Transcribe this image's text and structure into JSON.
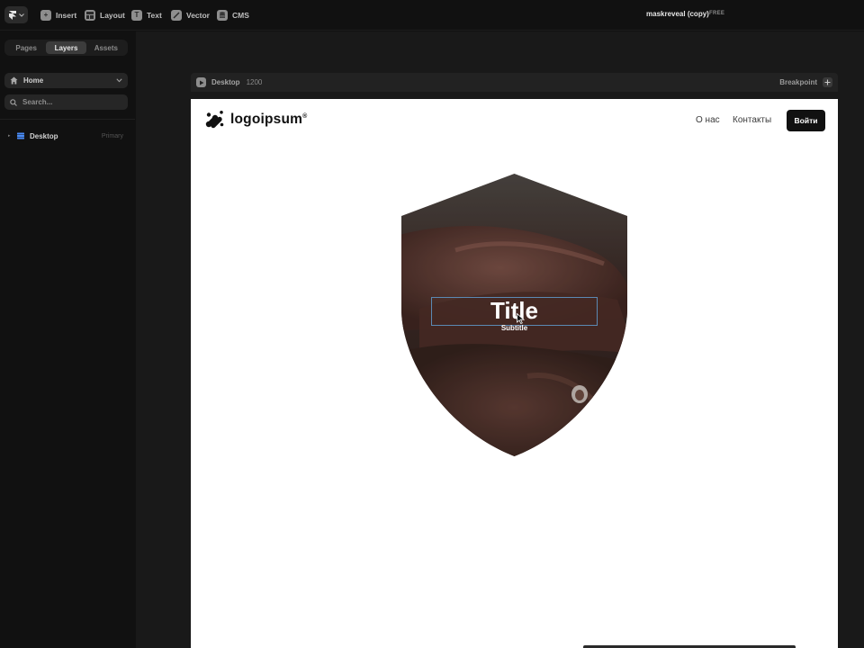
{
  "toolbar": {
    "menu_icon": "framer-logo-icon",
    "items": [
      {
        "label": "Insert",
        "icon": "plus-icon"
      },
      {
        "label": "Layout",
        "icon": "layout-icon"
      },
      {
        "label": "Text",
        "icon": "text-icon"
      },
      {
        "label": "Vector",
        "icon": "vector-icon"
      },
      {
        "label": "CMS",
        "icon": "database-icon"
      }
    ],
    "project_title": "maskreveal (copy)",
    "plan_badge": "FREE"
  },
  "left_panel": {
    "tabs": [
      {
        "label": "Pages",
        "active": false
      },
      {
        "label": "Layers",
        "active": true
      },
      {
        "label": "Assets",
        "active": false
      }
    ],
    "page_selector": {
      "value": "Home",
      "icon": "home-icon"
    },
    "search": {
      "placeholder": "Search..."
    },
    "layers": [
      {
        "label": "Desktop",
        "tag": "Primary",
        "icon": "stack-icon"
      }
    ]
  },
  "canvas": {
    "breakpoint_bar": {
      "name": "Desktop",
      "width": "1200",
      "action_label": "Breakpoint"
    }
  },
  "site": {
    "logo_text": "logoipsum",
    "logo_mark": "®",
    "nav": [
      "О нас",
      "Контакты"
    ],
    "login_label": "Войти",
    "hero_title": "Title",
    "hero_subtitle": "Subtitle"
  },
  "colors": {
    "app_bg": "#111111",
    "canvas_bg": "#191919",
    "frame_bg": "#ffffff",
    "selection": "#5b89b3",
    "layer_icon": "#4a8cf7"
  }
}
